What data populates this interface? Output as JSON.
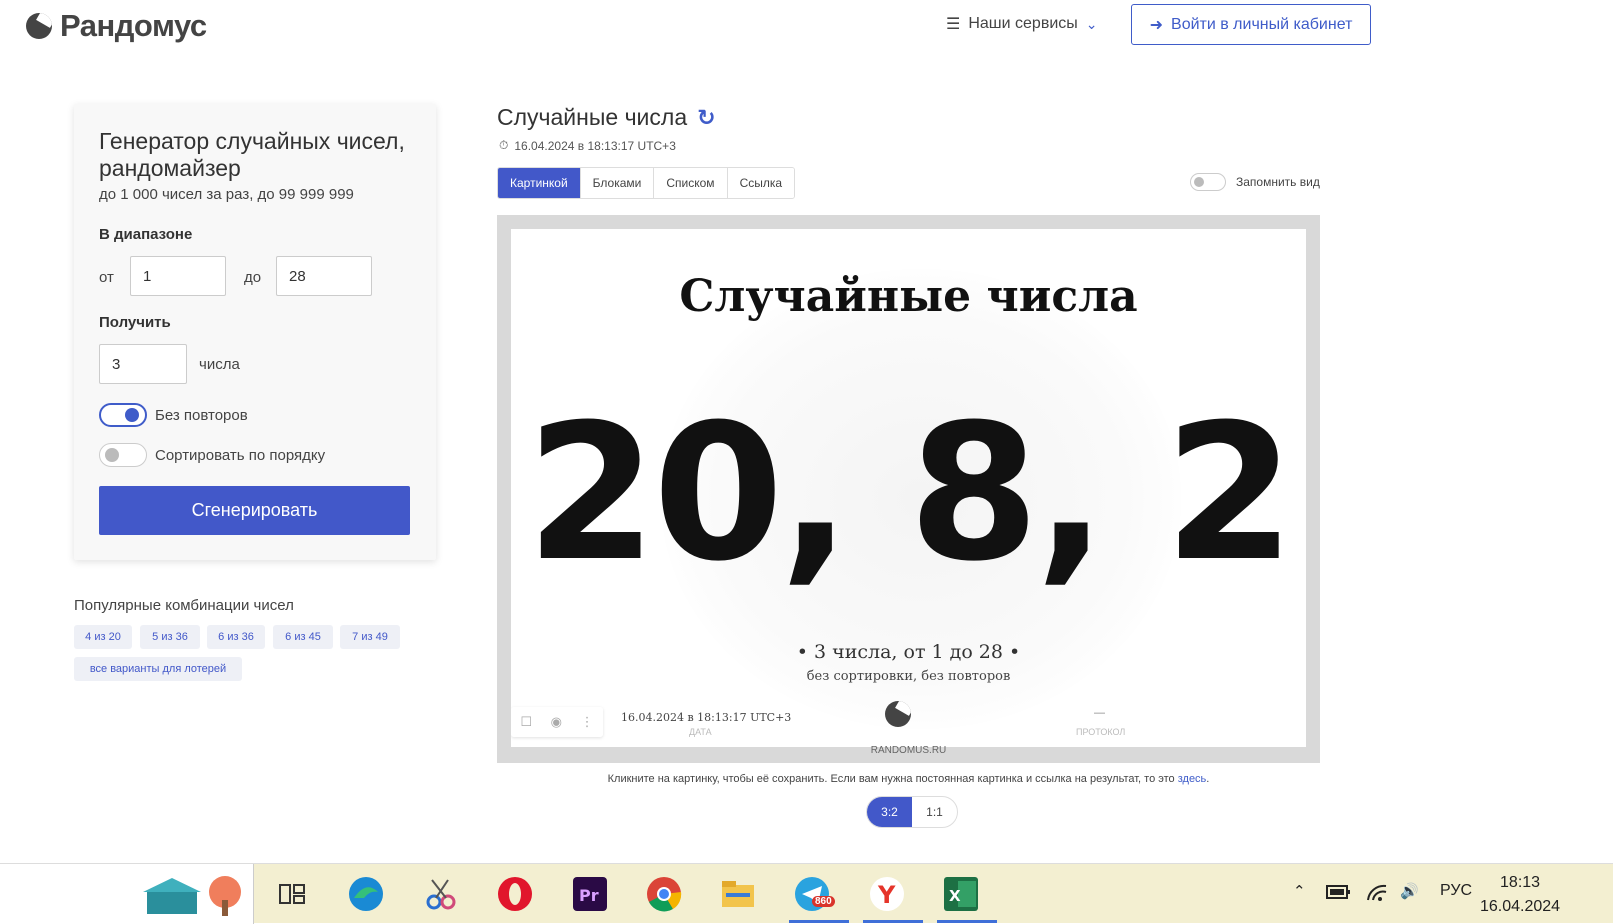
{
  "header": {
    "brand": "Рандомус",
    "services_label": "Наши сервисы",
    "login_label": "Войти в личный кабинет"
  },
  "generator": {
    "title": "Генератор случайных чисел, рандомайзер",
    "subtitle": "до 1 000 чисел за раз, до 99 999 999",
    "range_label": "В диапазоне",
    "from_label": "от",
    "from_value": "1",
    "to_label": "до",
    "to_value": "28",
    "get_label": "Получить",
    "count_value": "3",
    "count_unit": "числа",
    "no_repeat_label": "Без повторов",
    "no_repeat_on": true,
    "sort_label": "Сортировать по порядку",
    "sort_on": false,
    "generate_label": "Сгенерировать"
  },
  "popular": {
    "title": "Популярные комбинации чисел",
    "chips": [
      "4 из 20",
      "5 из 36",
      "6 из 36",
      "6 из 45",
      "7 из 49"
    ],
    "all_variants": "все варианты для лотерей"
  },
  "result": {
    "title": "Случайные числа",
    "timestamp": "16.04.2024 в 18:13:17 UTC+3",
    "tabs": [
      "Картинкой",
      "Блоками",
      "Списком",
      "Ссылка"
    ],
    "active_tab": "Картинкой",
    "remember_label": "Запомнить вид",
    "image_title": "Случайные числа",
    "numbers": "20, 8, 2",
    "summary": "• 3 числа, от 1 до 28 •",
    "summary_sub": "без сортировки, без повторов",
    "image_date": "16.04.2024 в 18:13:17 UTC+3",
    "image_date_caption": "ДАТА",
    "protocol_dash": "—",
    "protocol_caption": "ПРОТОКОЛ",
    "site_caption": "RANDOMUS.RU",
    "hint_text": "Кликните на картинку, чтобы её сохранить. Если вам нужна постоянная картинка и ссылка на результат, то это ",
    "hint_link": "здесь",
    "hint_end": ".",
    "ratios": [
      "3:2",
      "1:1"
    ],
    "active_ratio": "3:2"
  },
  "taskbar": {
    "telegram_badge": "860",
    "language": "РУС",
    "time": "18:13",
    "date": "16.04.2024"
  },
  "colors": {
    "accent": "#4258c9",
    "taskbar_bg": "#f3efd1"
  }
}
